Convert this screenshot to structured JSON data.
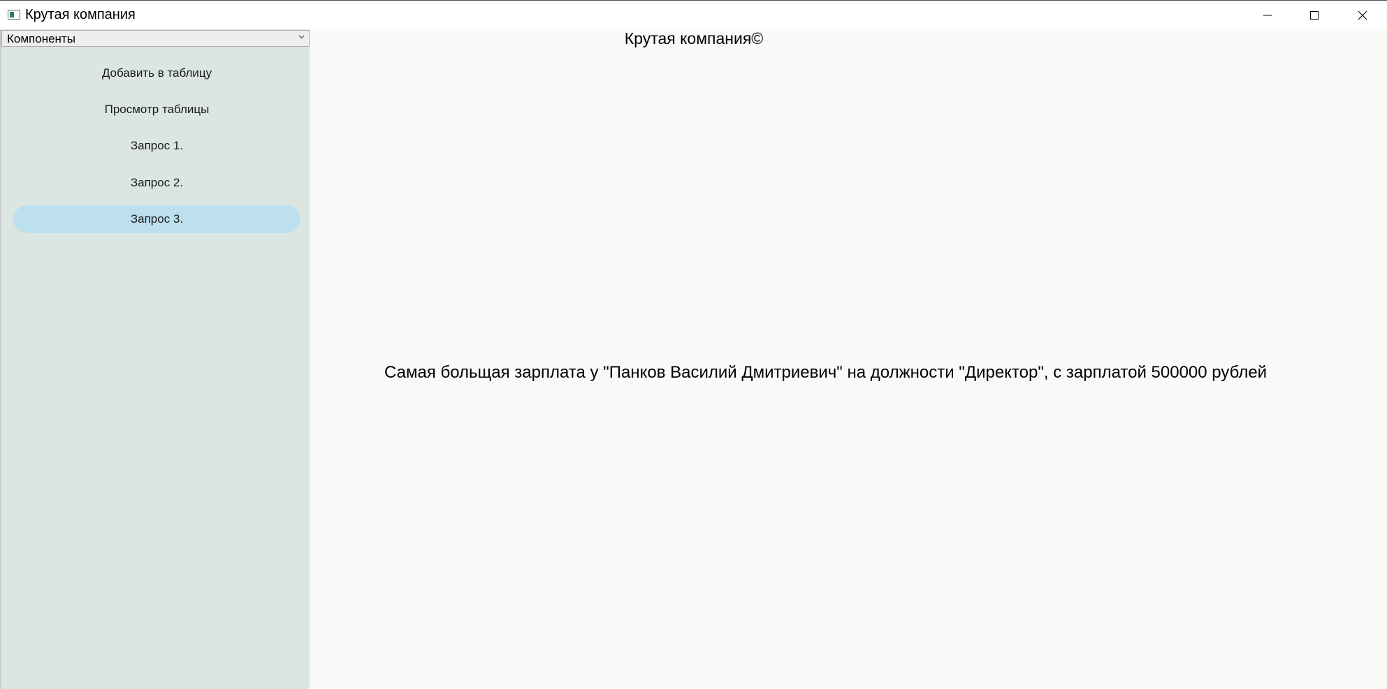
{
  "window": {
    "title": "Крутая компания",
    "accent_color": "#bde0ef",
    "sidebar_color": "#dbe5e1",
    "background_color": "#f8faf7"
  },
  "window_controls": {
    "minimize_icon": "minimize-icon",
    "maximize_icon": "maximize-icon",
    "close_icon": "close-icon"
  },
  "sidebar": {
    "combo": {
      "value": "Компоненты",
      "icon": "chevron-down-icon"
    },
    "items": [
      {
        "label": "Добавить в таблицу",
        "selected": false
      },
      {
        "label": "Просмотр таблицы",
        "selected": false
      },
      {
        "label": "Запрос 1.",
        "selected": false
      },
      {
        "label": "Запрос 2.",
        "selected": false
      },
      {
        "label": "Запрос 3.",
        "selected": true
      }
    ]
  },
  "main": {
    "header": "Крутая компания©",
    "result": "Самая больщая зарплата у \"Панков Василий Дмитриевич\" на должности \"Директор\", с зарплатой 500000 рублей"
  }
}
